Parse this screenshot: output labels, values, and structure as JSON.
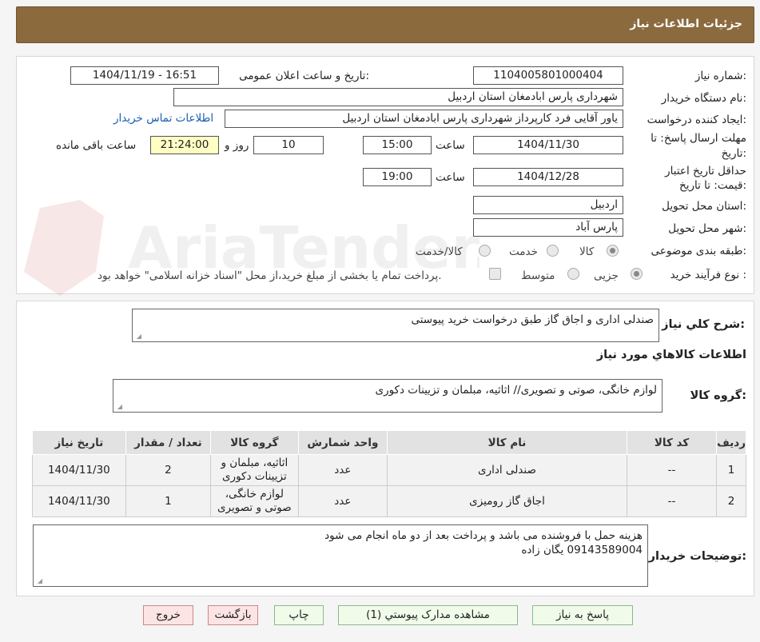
{
  "header": {
    "title": "جزئیات اطلاعات نیاز"
  },
  "form": {
    "need_number_label": "شماره نیاز:",
    "need_number": "1104005801000404",
    "announce_label": "تاریخ و ساعت اعلان عمومی:",
    "announce_value": "1404/11/19 - 16:51",
    "buyer_org_label": "نام دستگاه خریدار:",
    "buyer_org": "شهرداری پارس ابادمغان استان اردبیل",
    "creator_label": "ایجاد کننده درخواست:",
    "creator": "یاور آقایی فرد کارپرداز شهرداری پارس ابادمغان استان اردبیل",
    "contact_link": "اطلاعات تماس خریدار",
    "deadline_label_1": "مهلت ارسال پاسخ: تا",
    "deadline_label_2": "تاریخ:",
    "deadline_date": "1404/11/30",
    "time_label": "ساعت",
    "deadline_time": "15:00",
    "days_value": "10",
    "days_label": "روز و",
    "remaining_time": "21:24:00",
    "remaining_label": "ساعت باقی مانده",
    "validity_label_1": "حداقل تاریخ اعتبار",
    "validity_label_2": "قیمت: تا تاریخ:",
    "validity_date": "1404/12/28",
    "validity_time": "19:00",
    "province_label": "استان محل تحویل:",
    "province": "اردبیل",
    "city_label": "شهر محل تحویل:",
    "city": "پارس آباد",
    "category_label": "طبقه بندی موضوعی:",
    "category_options": [
      "کالا",
      "خدمت",
      "کالا/خدمت"
    ],
    "process_label": "نوع فرآیند خرید :",
    "process_options": [
      "جزیی",
      "متوسط"
    ],
    "payment_note": "پرداخت تمام یا بخشی از مبلغ خرید،از محل \"اسناد خزانه اسلامی\" خواهد بود."
  },
  "summary": {
    "title_label": "شرح کلي نياز:",
    "title_value": "صندلی اداری و اجاق گاز طبق درخواست خرید پیوستی",
    "goods_info_title": "اطلاعات کالاهاي مورد نياز",
    "group_label": "گروه کالا:",
    "group_value": "لوازم خانگی، صوتی و تصویری// اثاثیه، مبلمان و تزیینات دکوری"
  },
  "table": {
    "headers": [
      "ردیف",
      "کد کالا",
      "نام کالا",
      "واحد شمارش",
      "گروه کالا",
      "تعداد / مقدار",
      "تاریخ نیاز"
    ],
    "rows": [
      [
        "1",
        "--",
        "صندلی اداری",
        "عدد",
        "اثاثیه، مبلمان و تزیینات دکوری",
        "2",
        "1404/11/30"
      ],
      [
        "2",
        "--",
        "اجاق گاز رومیزی",
        "عدد",
        "لوازم خانگی، صوتی و تصویری",
        "1",
        "1404/11/30"
      ]
    ]
  },
  "buyer_notes": {
    "label": "توضیحات خریدار:",
    "line1": "هزینه حمل با فروشنده  می باشد و پرداخت بعد از دو ماه انجام می شود",
    "line2": "09143589004 یگان زاده"
  },
  "buttons": {
    "reply": "پاسخ به نیاز",
    "view_docs": "مشاهده مدارک پیوستي (1)",
    "print": "چاپ",
    "back": "بازگشت",
    "exit": "خروج"
  },
  "watermark_text": "AriaTender.neT"
}
